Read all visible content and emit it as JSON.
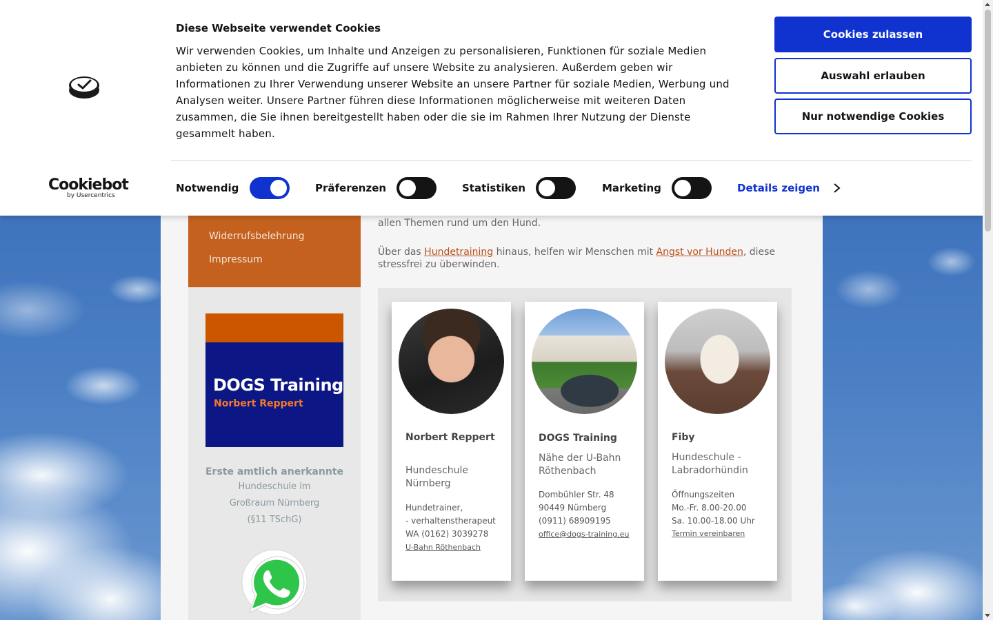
{
  "colors": {
    "brand_orange": "#c5611f",
    "cookie_accent": "#1032cf",
    "logo_navy": "#0d1685"
  },
  "sidebar": {
    "nav_items": [
      {
        "label": "Widerrufsbelehrung"
      },
      {
        "label": "Impressum"
      }
    ],
    "logo": {
      "brand": "DOGS Training",
      "subtitle": "Norbert Reppert"
    },
    "claim": {
      "line1": "Erste amtlich anerkannte",
      "line2": "Hundeschule im",
      "line3": "Großraum Nürnberg",
      "line4": "(§11 TSchG)"
    },
    "whatsapp_icon": "whatsapp-icon"
  },
  "main": {
    "intro_tail": "allen Themen rund um den Hund.",
    "paragraph": {
      "p1": "Über das ",
      "link1": "Hundetraining",
      "p2": " hinaus, helfen wir Menschen mit ",
      "link2": "Angst vor Hunden",
      "p3": ", diese stressfrei zu überwinden."
    },
    "cards": [
      {
        "name": "Norbert Reppert",
        "role": "Hundeschule Nürnberg",
        "info": [
          "Hundetrainer,",
          "- verhaltenstherapeut",
          "WA (0162) 3039278"
        ],
        "link": "U-Bahn Röthenbach"
      },
      {
        "name": "DOGS Training",
        "role": "Nähe der U-Bahn Röthenbach",
        "info": [
          "Dombühler Str. 48",
          "90449 Nürnberg",
          "(0911) 68909195"
        ],
        "link": "office@dogs-training.eu"
      },
      {
        "name": "Fiby",
        "role": "Hundeschule - Labradorhündin",
        "info": [
          "Öffnungszeiten",
          "Mo.-Fr. 8.00-20.00",
          "Sa. 10.00-18.00 Uhr"
        ],
        "link": "Termin vereinbaren"
      }
    ]
  },
  "cookie_banner": {
    "title": "Diese Webseite verwendet Cookies",
    "text": "Wir verwenden Cookies, um Inhalte und Anzeigen zu personalisieren, Funktionen für soziale Medien anbieten zu können und die Zugriffe auf unsere Website zu analysieren. Außerdem geben wir Informationen zu Ihrer Verwendung unserer Website an unsere Partner für soziale Medien, Werbung und Analysen weiter. Unsere Partner führen diese Informationen möglicherweise mit weiteren Daten zusammen, die Sie ihnen bereitgestellt haben oder die sie im Rahmen Ihrer Nutzung der Dienste gesammelt haben.",
    "buttons": {
      "allow_all": "Cookies zulassen",
      "allow_selection": "Auswahl erlauben",
      "necessary_only": "Nur notwendige Cookies"
    },
    "logo": {
      "big": "Cookiebot",
      "small": "by Usercentrics"
    },
    "toggles": [
      {
        "label": "Notwendig",
        "on": true
      },
      {
        "label": "Präferenzen",
        "on": false
      },
      {
        "label": "Statistiken",
        "on": false
      },
      {
        "label": "Marketing",
        "on": false
      }
    ],
    "details_label": "Details zeigen"
  }
}
